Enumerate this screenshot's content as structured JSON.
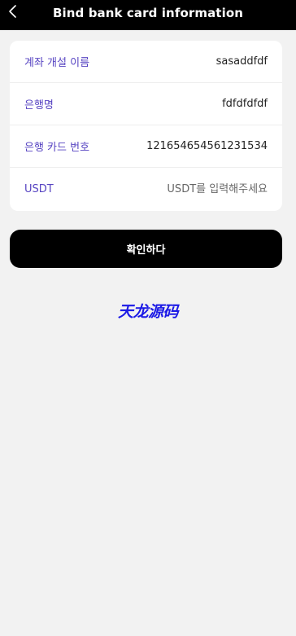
{
  "header": {
    "title": "Bind bank card information",
    "back_icon": "chevron-left-icon"
  },
  "form": {
    "rows": [
      {
        "label": "계좌 개설 이름",
        "value": "sasaddfdf"
      },
      {
        "label": "은행명",
        "value": "fdfdfdfdf"
      },
      {
        "label": "은행 카드 번호",
        "value": "121654654561231534"
      },
      {
        "label": "USDT",
        "value": "",
        "placeholder": "USDT를 입력해주세요"
      }
    ]
  },
  "confirm_button": {
    "label": "확인하다"
  },
  "watermark": {
    "text": "天龙源码"
  },
  "colors": {
    "header_bg": "#000000",
    "label": "#5744c2",
    "button_bg": "#000000",
    "watermark": "#1b19e6",
    "page_bg": "#f2f2f2"
  }
}
